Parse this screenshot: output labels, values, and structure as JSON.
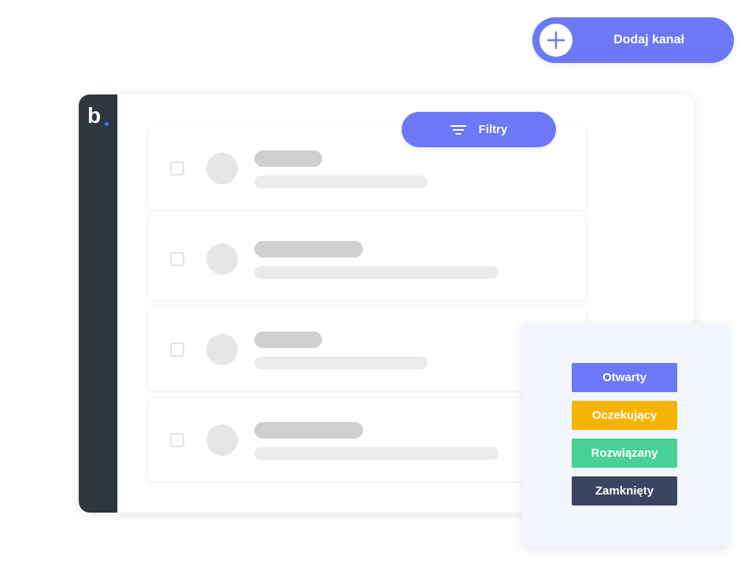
{
  "add_channel": {
    "label": "Dodaj kanał",
    "icon": "plus-icon"
  },
  "filter": {
    "label": "Filtry",
    "icon": "filter-icon"
  },
  "brand": {
    "logo_text": "b",
    "accent_color": "#4f7cff"
  },
  "colors": {
    "primary": "#6c78f5",
    "sidebar": "#2e3640"
  },
  "statuses": [
    {
      "label": "Otwarty",
      "color": "#6c78f5"
    },
    {
      "label": "Oczekujący",
      "color": "#f5b400"
    },
    {
      "label": "Rozwiązany",
      "color": "#47d196"
    },
    {
      "label": "Zamknięty",
      "color": "#3b4560"
    }
  ]
}
